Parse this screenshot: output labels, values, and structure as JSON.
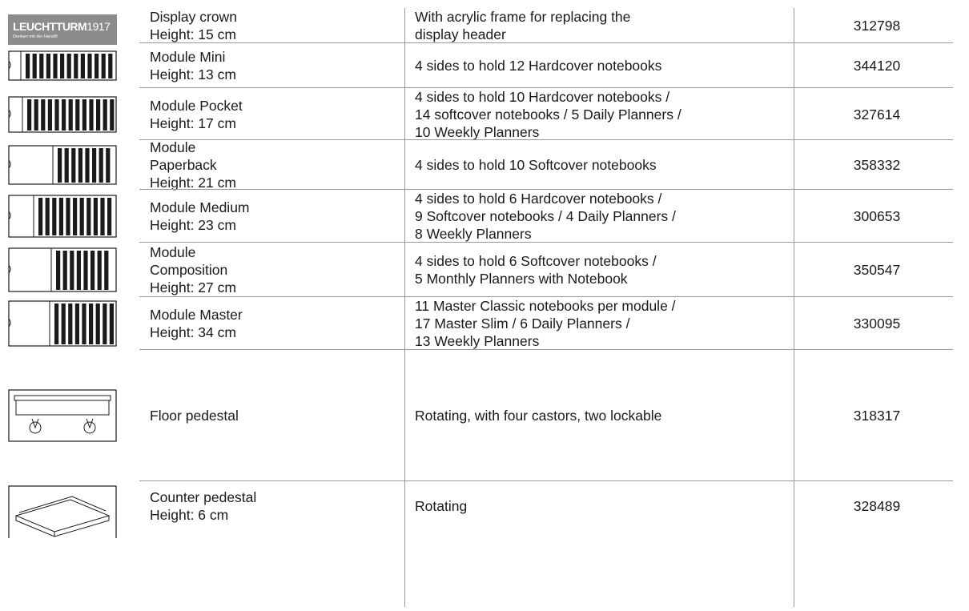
{
  "logo": {
    "brand": "LEUCHTTURM",
    "year": "1917",
    "tagline": "Denken mit der Hand®"
  },
  "rows": [
    {
      "icon": "leuchtturm-logo",
      "name": [
        "Display crown",
        "Height: 15 cm"
      ],
      "description": [
        "With acrylic frame for replacing the",
        "display header"
      ],
      "number": "312798"
    },
    {
      "icon": "module-mini-icon",
      "name": [
        "Module Mini",
        "Height: 13 cm"
      ],
      "description": [
        "4 sides to hold 12 Hardcover notebooks"
      ],
      "number": "344120"
    },
    {
      "icon": "module-pocket-icon",
      "name": [
        "Module Pocket",
        "Height: 17 cm"
      ],
      "description": [
        "4 sides to hold 10 Hardcover notebooks /",
        "14 softcover notebooks / 5 Daily Planners /",
        "10 Weekly Planners"
      ],
      "number": "327614"
    },
    {
      "icon": "module-paperback-icon",
      "name": [
        "Module",
        "Paperback",
        "Height: 21 cm"
      ],
      "description": [
        "4 sides to hold 10 Softcover notebooks"
      ],
      "number": "358332"
    },
    {
      "icon": "module-medium-icon",
      "name": [
        "Module Medium",
        "Height: 23 cm"
      ],
      "description": [
        "4 sides to hold 6 Hardcover notebooks /",
        "9 Softcover notebooks / 4 Daily Planners /",
        "8 Weekly Planners"
      ],
      "number": "300653"
    },
    {
      "icon": "module-composition-icon",
      "name": [
        "Module",
        "Composition",
        "Height: 27 cm"
      ],
      "description": [
        "4 sides to hold 6 Softcover notebooks /",
        "5 Monthly Planners with Notebook"
      ],
      "number": "350547"
    },
    {
      "icon": "module-master-icon",
      "name": [
        "Module Master",
        "Height: 34 cm"
      ],
      "description": [
        "11 Master Classic notebooks per module /",
        "17 Master Slim / 6 Daily Planners /",
        "13 Weekly Planners"
      ],
      "number": "330095"
    },
    {
      "icon": "floor-pedestal-icon",
      "name": [
        "Floor pedestal"
      ],
      "description": [
        "Rotating, with four castors, two lockable"
      ],
      "number": "318317"
    },
    {
      "icon": "counter-pedestal-icon",
      "name": [
        "Counter pedestal",
        "Height: 6 cm"
      ],
      "description": [
        "Rotating"
      ],
      "number": "328489"
    }
  ],
  "colors": {
    "text": "#1a1a1a",
    "rule": "#9a9a9a",
    "logo_bg": "#8c8c8c"
  }
}
